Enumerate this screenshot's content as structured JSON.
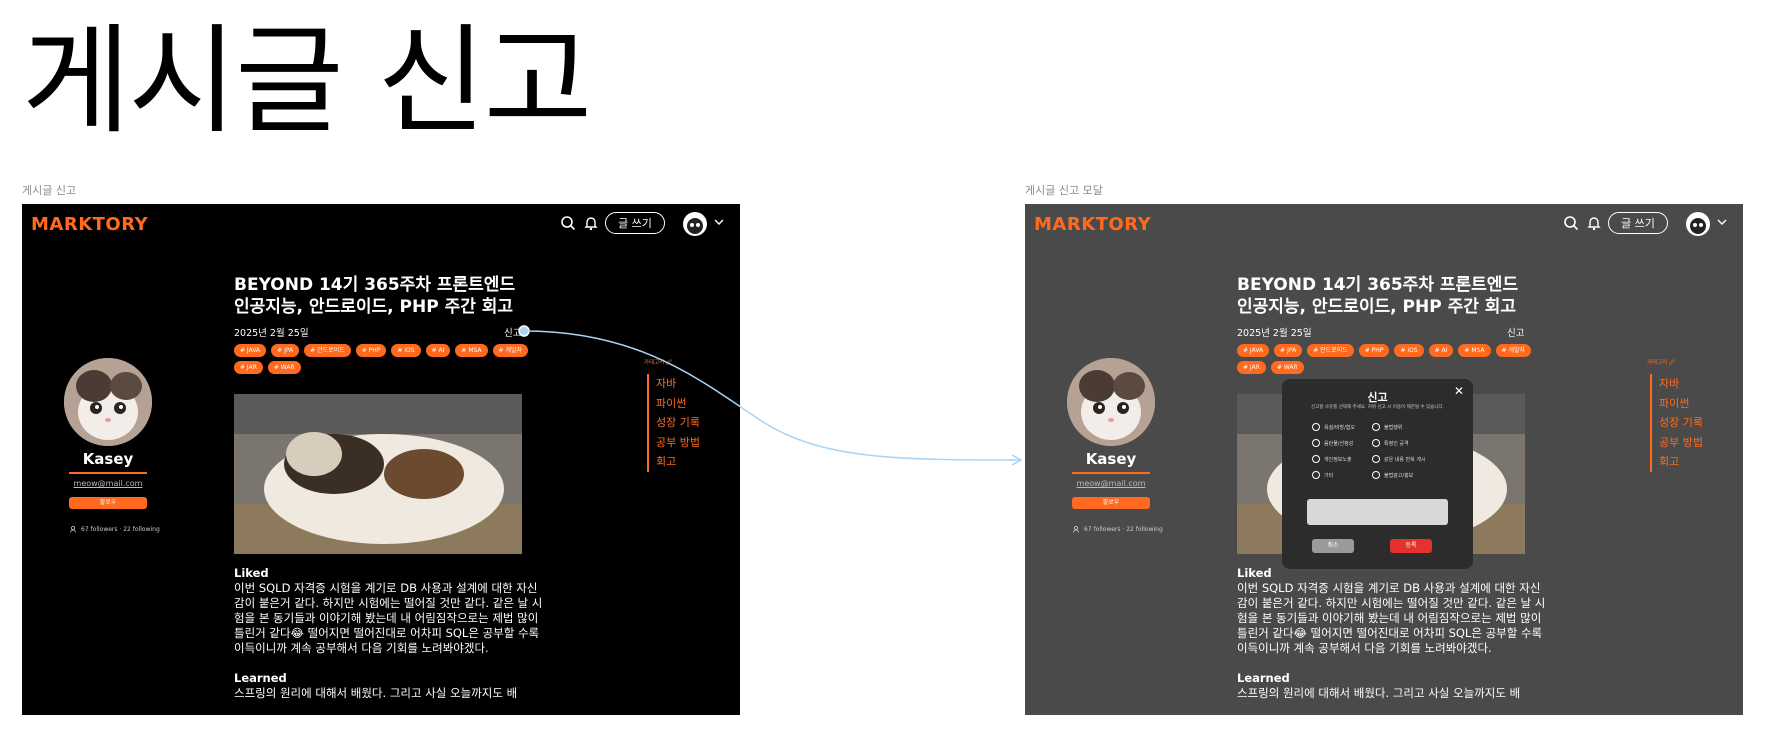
{
  "canvas": {
    "title": "게시글 신고"
  },
  "frames": [
    {
      "label": "게시글 신고",
      "app": {
        "logo": "MARKTORY",
        "write_button": "글 쓰기",
        "post": {
          "title": "BEYOND 14기 365주차 프론트엔드 인공지능, 안드로이드, PHP 주간 회고",
          "date": "2025년 2월 25일",
          "report_label": "신고",
          "tags": [
            "# JAVA",
            "# JPA",
            "# 안드로이드",
            "# PHP",
            "# iOS",
            "# AI",
            "# MSA",
            "# 개발자",
            "# JAR",
            "# WAR"
          ],
          "liked_heading": "Liked",
          "liked_text": "이번 SQLD 자격증 시험을 계기로 DB 사용과 설계에 대한 자신감이 붙은거 같다. 하지만 시험에는 떨어질 것만 같다. 같은 날 시험을 본 동기들과 이야기해 봤는데 내 어림짐작으로는 제법 많이 틀린거 같다😂 떨어지면 떨어진대로 어차피 SQL은 공부할 수록 이득이니까 계속 공부해서 다음 기회를 노려봐야겠다.",
          "learned_heading": "Learned",
          "learned_text": "스프링의 원리에 대해서 배웠다. 그리고 사실 오늘까지도 배"
        },
        "profile": {
          "name": "Kasey",
          "email": "meow@mail.com",
          "follow_button": "팔로우",
          "stats": "67 followers · 22 following"
        },
        "toc": {
          "label": "카테고리 🖉",
          "items": [
            "자바",
            "파이썬",
            "성장 기록",
            "공부 방법",
            "회고"
          ]
        }
      }
    },
    {
      "label": "게시글 신고 모달",
      "modal": {
        "title": "신고",
        "close": "✕",
        "description": "신고할 사유를 선택해 주세요. 허위 신고 시 이용이 제한될 수 있습니다.",
        "reasons": [
          "욕설/비방/혐오",
          "불법행위",
          "음란물/선정성",
          "특정인 공격",
          "개인정보노출",
          "같은 내용 반복 게시",
          "기타",
          "불법광고/홍보"
        ],
        "cancel": "취소",
        "submit": "등록"
      }
    }
  ],
  "colors": {
    "accent": "#ff6a1f",
    "danger": "#e5322d",
    "arrow": "#a9d4f5"
  }
}
